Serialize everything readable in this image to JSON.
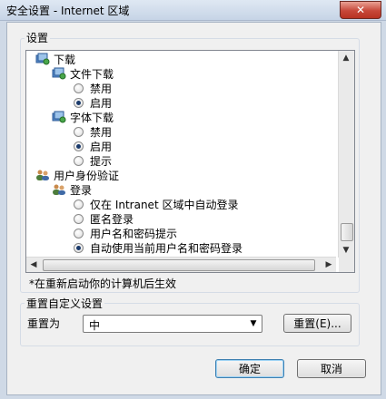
{
  "window": {
    "title": "安全设置 - Internet 区域",
    "close_label": "✕"
  },
  "settings": {
    "group_label": "设置",
    "tree": [
      {
        "type": "category",
        "label": "下载",
        "icon": "gear-icon"
      },
      {
        "type": "subcategory",
        "label": "文件下载",
        "icon": "gear-icon"
      },
      {
        "type": "radio",
        "label": "禁用",
        "checked": false
      },
      {
        "type": "radio",
        "label": "启用",
        "checked": true
      },
      {
        "type": "subcategory",
        "label": "字体下载",
        "icon": "gear-icon"
      },
      {
        "type": "radio",
        "label": "禁用",
        "checked": false
      },
      {
        "type": "radio",
        "label": "启用",
        "checked": true
      },
      {
        "type": "radio",
        "label": "提示",
        "checked": false
      },
      {
        "type": "category",
        "label": "用户身份验证",
        "icon": "users-icon"
      },
      {
        "type": "subcategory",
        "label": "登录",
        "icon": "users-icon"
      },
      {
        "type": "radio",
        "label": "仅在 Intranet 区域中自动登录",
        "checked": false
      },
      {
        "type": "radio",
        "label": "匿名登录",
        "checked": false
      },
      {
        "type": "radio",
        "label": "用户名和密码提示",
        "checked": false
      },
      {
        "type": "radio",
        "label": "自动使用当前用户名和密码登录",
        "checked": true
      }
    ],
    "note": "*在重新启动你的计算机后生效"
  },
  "reset": {
    "group_label": "重置自定义设置",
    "reset_to_label": "重置为",
    "selected_level": "中",
    "reset_button": "重置(E)..."
  },
  "footer": {
    "ok_button": "确定",
    "cancel_button": "取消"
  }
}
